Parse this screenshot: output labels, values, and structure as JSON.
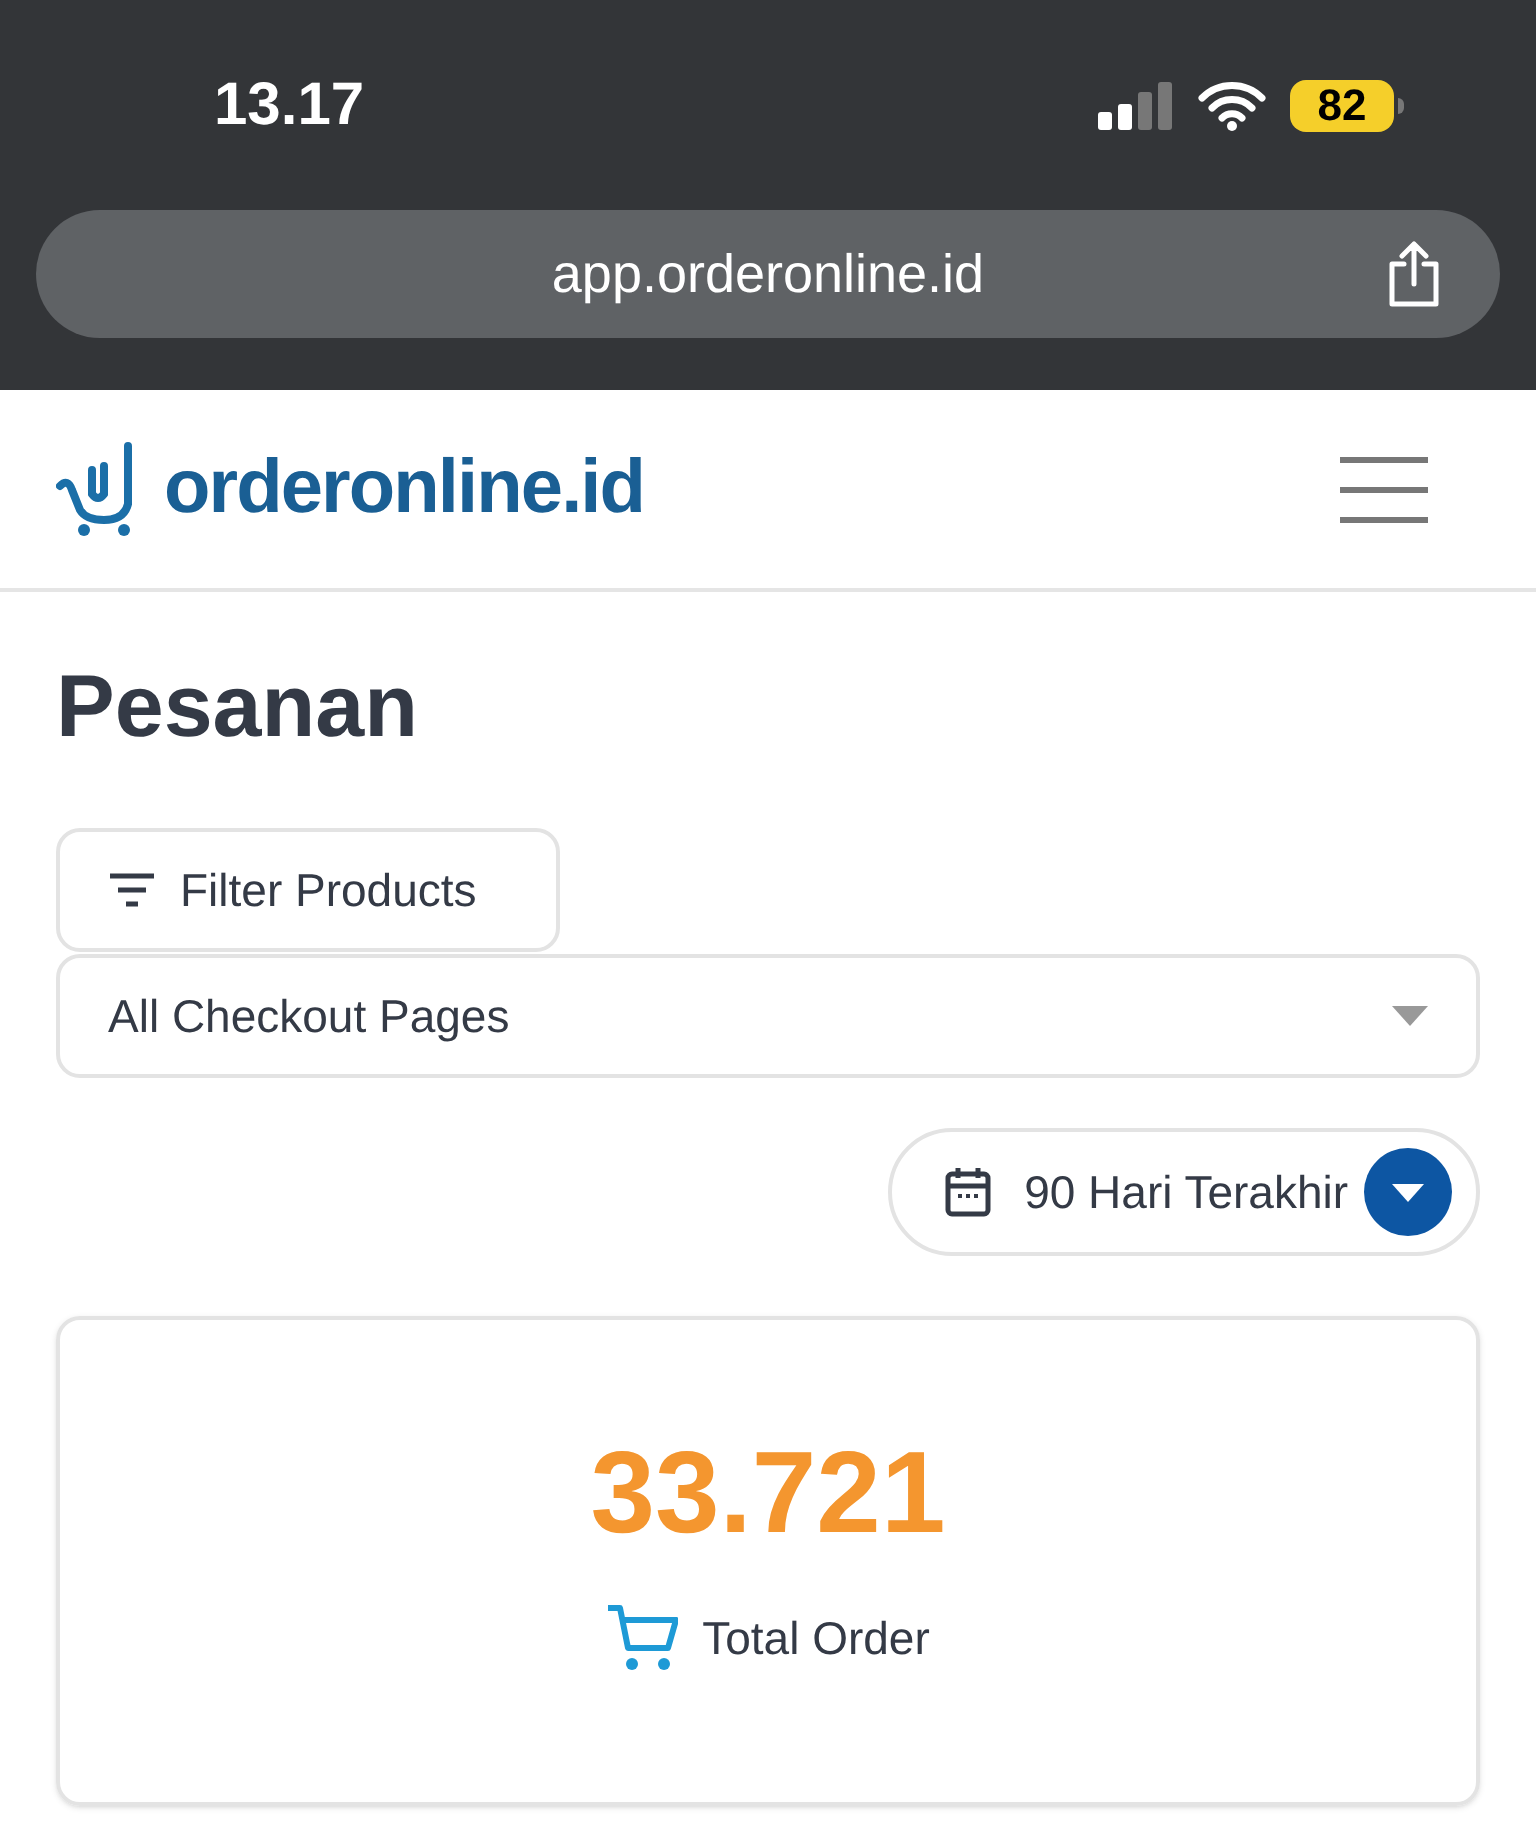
{
  "status_bar": {
    "time": "13.17",
    "battery": "82"
  },
  "browser": {
    "url": "app.orderonline.id"
  },
  "header": {
    "logo": "orderonline.id"
  },
  "page": {
    "title": "Pesanan"
  },
  "filters": {
    "filter_button": "Filter Products",
    "checkout_select": "All Checkout Pages",
    "date_range": "90 Hari Terakhir"
  },
  "stat_card": {
    "value": "33.721",
    "label": "Total Order"
  }
}
